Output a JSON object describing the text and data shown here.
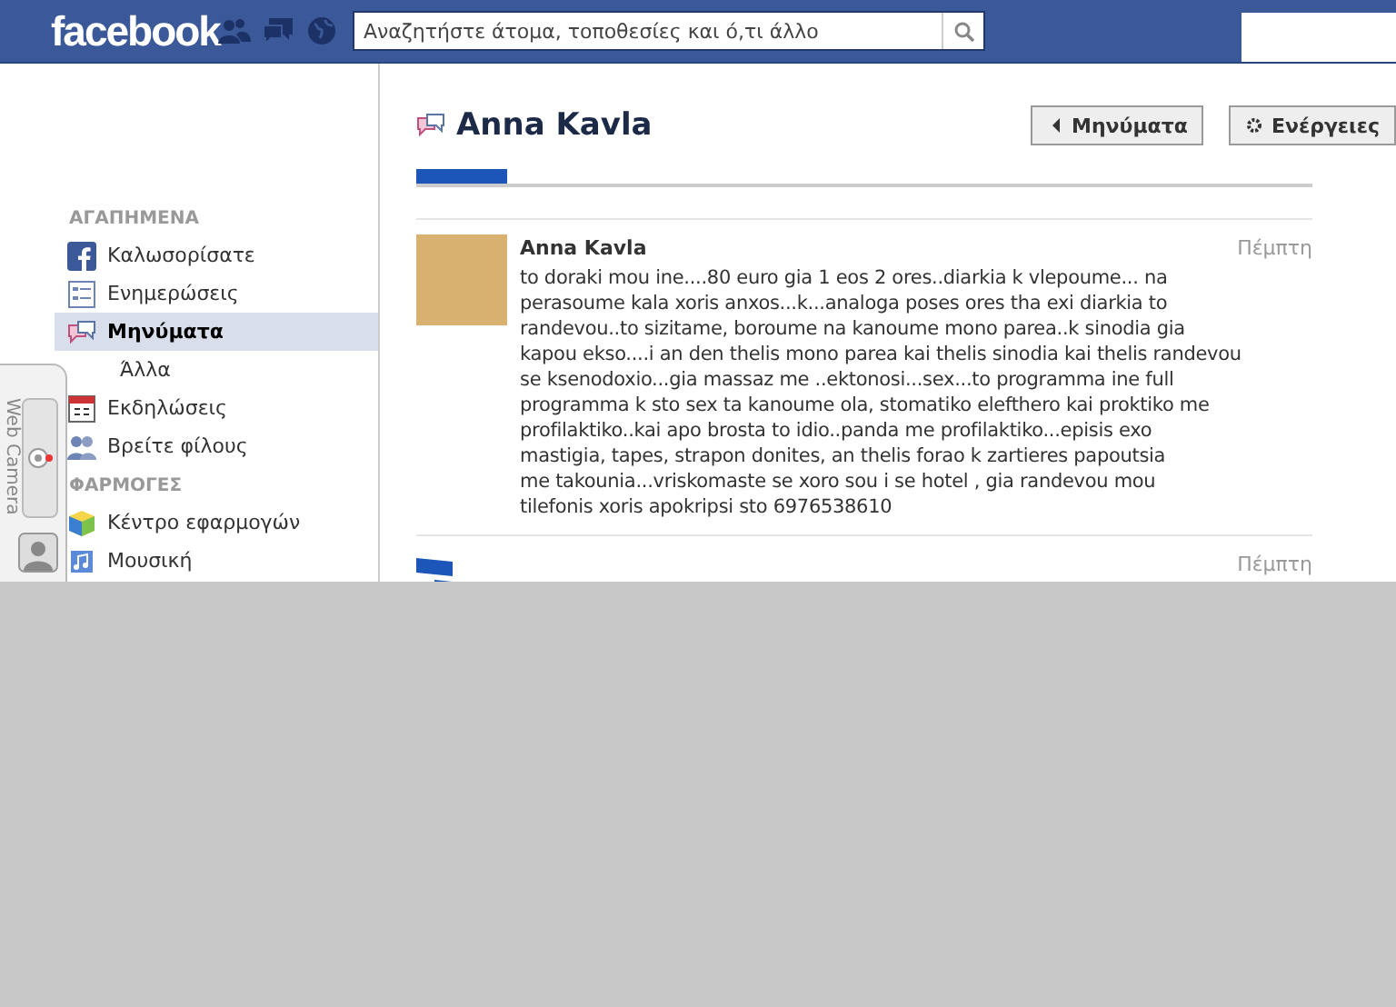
{
  "header": {
    "logo": "facebook",
    "search": {
      "placeholder": "Αναζητήστε άτομα, τοποθεσίες και ό,τι άλλο"
    }
  },
  "sidebar": {
    "sections": [
      {
        "title": "ΑΓΑΠΗΜΕΝΑ",
        "items": [
          {
            "label": "Καλωσορίσατε",
            "selected": false
          },
          {
            "label": "Ενημερώσεις",
            "selected": false
          },
          {
            "label": "Μηνύματα",
            "selected": true,
            "children": [
              {
                "label": "Άλλα",
                "selected": false
              }
            ]
          },
          {
            "label": "Εκδηλώσεις",
            "selected": false
          },
          {
            "label": "Βρείτε φίλους",
            "selected": false
          }
        ]
      },
      {
        "title": "ΦΑΡΜΟΓΕΣ",
        "items": [
          {
            "label": "Κέντρο εφαρμογών",
            "selected": false
          },
          {
            "label": "Μουσική",
            "selected": false
          }
        ]
      }
    ]
  },
  "webcam": {
    "label": "Web Camera"
  },
  "thread": {
    "title": "Anna Kavla",
    "back_button": "Μηνύματα",
    "actions_button": "Ενέργειες",
    "messages": [
      {
        "sender": "Anna Kavla",
        "time": "Πέμπτη",
        "lines": [
          "to doraki mou ine....80 euro gia 1 eos 2 ores..diarkia k vlepoume... na",
          "perasoume kala xoris anxos...k...analoga poses ores tha exi diarkia to",
          "randevou..to sizitame, boroume na kanoume mono parea..k sinodia gia",
          "kapou ekso....i an den thelis mono parea kai thelis sinodia kai thelis randevou",
          "se ksenodoxio...gia massaz me ..ektonosi...sex...to programma ine full",
          "programma k sto sex ta kanoume ola, stomatiko elefthero kai proktiko me",
          "profilaktiko..kai apo brosta to idio..panda me profilaktiko...episis exo",
          "mastigia, tapes, strapon donites, an thelis forao k zartieres papoutsia",
          "me takounia...vriskomaste se xoro sou i se hotel , gia randevou mou",
          "tilefonis xoris apokripsi sto 6976538610"
        ]
      },
      {
        "time": "Πέμπτη"
      }
    ]
  }
}
